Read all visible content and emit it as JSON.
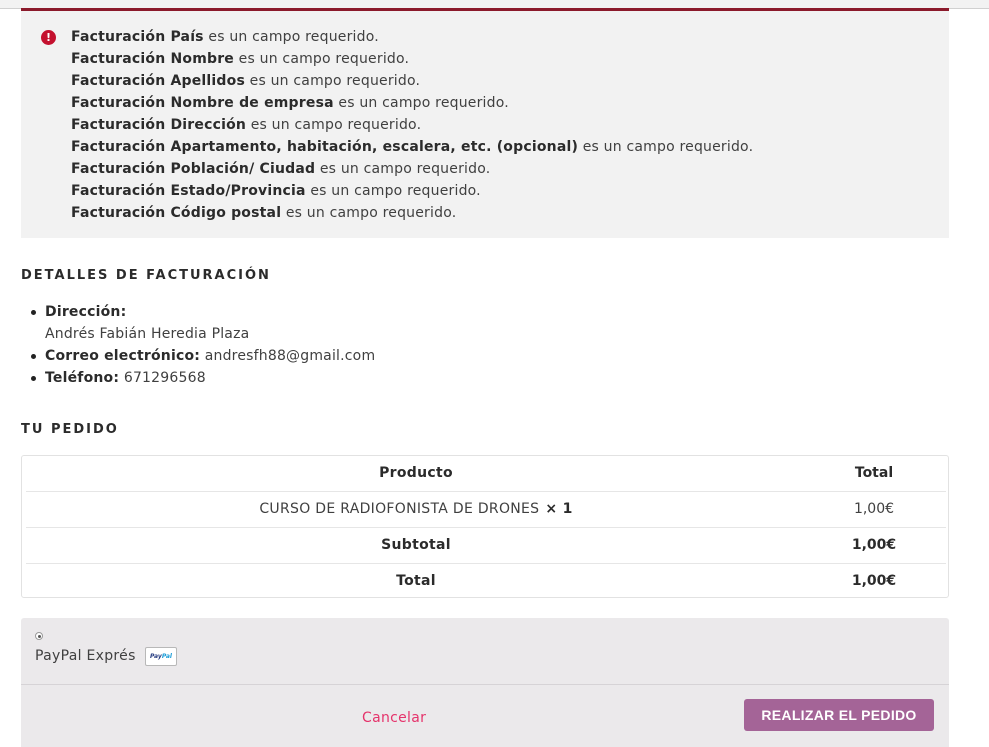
{
  "errors": {
    "icon": "exclamation-circle-icon",
    "color": "#c4112f",
    "suffix": " es un campo requerido.",
    "items": [
      {
        "field": "Facturación País"
      },
      {
        "field": "Facturación Nombre"
      },
      {
        "field": "Facturación Apellidos"
      },
      {
        "field": "Facturación Nombre de empresa"
      },
      {
        "field": "Facturación Dirección"
      },
      {
        "field": "Facturación Apartamento, habitación, escalera, etc. (opcional)"
      },
      {
        "field": "Facturación Población/ Ciudad"
      },
      {
        "field": "Facturación Estado/Provincia"
      },
      {
        "field": "Facturación Código postal"
      }
    ]
  },
  "billing": {
    "title": "DETALLES DE FACTURACIÓN",
    "address_label": "Dirección:",
    "address_value": "Andrés Fabián Heredia Plaza",
    "email_label": "Correo electrónico:",
    "email_value": "andresfh88@gmail.com",
    "phone_label": "Teléfono:",
    "phone_value": "671296568"
  },
  "order": {
    "title": "TU PEDIDO",
    "header_product": "Producto",
    "header_total": "Total",
    "item_name": "CURSO DE RADIOFONISTA DE DRONES",
    "item_qty": "× 1",
    "item_total": "1,00€",
    "subtotal_label": "Subtotal",
    "subtotal_value": "1,00€",
    "total_label": "Total",
    "total_value": "1,00€"
  },
  "payment": {
    "method_label": "PayPal Exprés",
    "badge_icon": "paypal-icon",
    "cancel_label": "Cancelar",
    "place_order_label": "REALIZAR EL PEDIDO",
    "button_color": "#a46497",
    "cancel_color": "#e5336b"
  }
}
